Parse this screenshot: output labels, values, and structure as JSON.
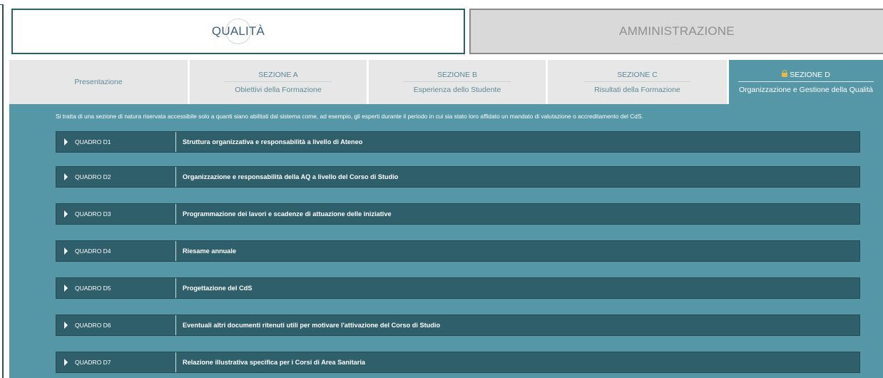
{
  "top_tabs": [
    {
      "label": "QUALITÀ",
      "active": true
    },
    {
      "label": "AMMINISTRAZIONE",
      "active": false
    }
  ],
  "sections": [
    {
      "title": "Presentazione",
      "subtitle": ""
    },
    {
      "title": "SEZIONE A",
      "subtitle": "Obiettivi della Formazione"
    },
    {
      "title": "SEZIONE B",
      "subtitle": "Esperienza dello Studente"
    },
    {
      "title": "SEZIONE C",
      "subtitle": "Risultati della Formazione"
    },
    {
      "title": "SEZIONE D",
      "subtitle": "Organizzazione e Gestione della Qualità",
      "locked": true,
      "active": true
    }
  ],
  "intro_text": "Si tratta di una sezione di natura riservata accessibile solo a quanti siano abilitati dal sistema come, ad esempio, gli esperti durante il periodo in cui sia stato loro affidato un mandato di valutazione o accreditamento del CdS.",
  "quadri": [
    {
      "code": "QUADRO D1",
      "title": "Struttura organizzativa e responsabilità a livello di Ateneo"
    },
    {
      "code": "QUADRO D2",
      "title": "Organizzazione e responsabilità della AQ a livello del Corso di Studio"
    },
    {
      "code": "QUADRO D3",
      "title": "Programmazione dei lavori e scadenze di attuazione delle iniziative"
    },
    {
      "code": "QUADRO D4",
      "title": "Riesame annuale"
    },
    {
      "code": "QUADRO D5",
      "title": "Progettazione del CdS"
    },
    {
      "code": "QUADRO D6",
      "title": "Eventuali altri documenti ritenuti utili per motivare l'attivazione del Corso di Studio"
    },
    {
      "code": "QUADRO D7",
      "title": "Relazione illustrativa specifica per i Corsi di Area Sanitaria"
    }
  ],
  "colors": {
    "panel": "#5597a6",
    "quadro": "#2f5f6a",
    "inactive_tab": "#e7e7e7",
    "lock": "#e8b84a"
  }
}
